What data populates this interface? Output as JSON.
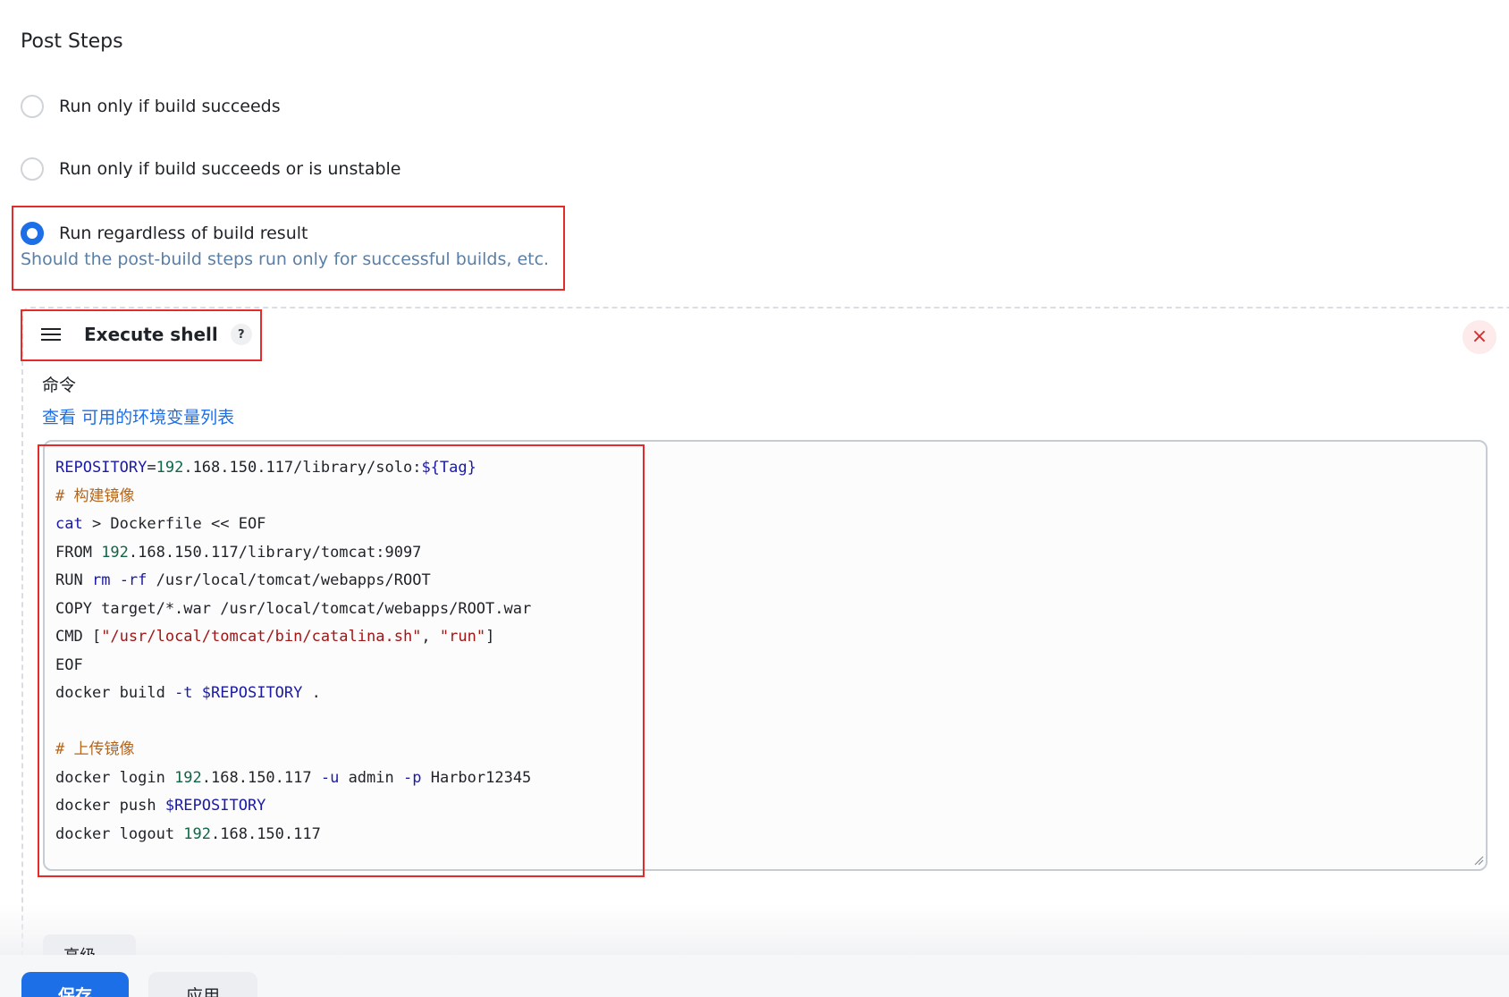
{
  "section": {
    "title": "Post Steps"
  },
  "radios": [
    {
      "label": "Run only if build succeeds",
      "checked": false
    },
    {
      "label": "Run only if build succeeds or is unstable",
      "checked": false
    },
    {
      "label": "Run regardless of build result",
      "checked": true
    }
  ],
  "radio_description": "Should the post-build steps run only for successful builds, etc.",
  "step": {
    "title": "Execute shell",
    "help_label": "?",
    "close_label": "×",
    "command_label": "命令",
    "env_link_prefix": "查看",
    "env_link_text": "可用的环境变量列表"
  },
  "code_lines": [
    "REPOSITORY=192.168.150.117/library/solo:${Tag}",
    "# 构建镜像",
    "cat > Dockerfile << EOF",
    "FROM 192.168.150.117/library/tomcat:9097",
    "RUN rm -rf /usr/local/tomcat/webapps/ROOT",
    "COPY target/*.war /usr/local/tomcat/webapps/ROOT.war",
    "CMD [\"/usr/local/tomcat/bin/catalina.sh\", \"run\"]",
    "EOF",
    "docker build -t $REPOSITORY .",
    "",
    "# 上传镜像",
    "docker login 192.168.150.117 -u admin -p Harbor12345",
    "docker push $REPOSITORY",
    "docker logout 192.168.150.117"
  ],
  "buttons": {
    "advanced": "高级",
    "save": "保存",
    "apply": "应用"
  },
  "colors": {
    "accent": "#1d6fe8",
    "highlight_border": "#e52a2a",
    "keyword": "#1a1aa6",
    "number": "#116644",
    "string": "#a31515",
    "comment": "#b4651c"
  }
}
